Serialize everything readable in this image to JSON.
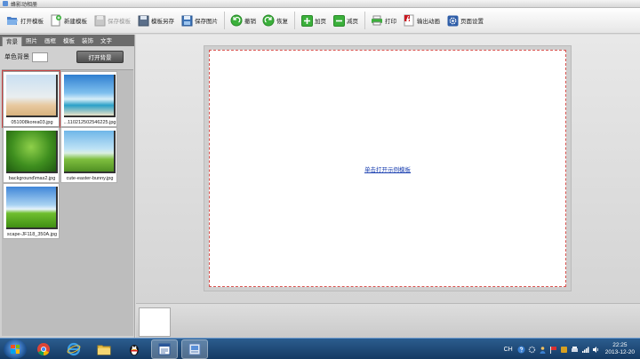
{
  "window": {
    "title": "蜂影动相册"
  },
  "toolbar": {
    "open_template": "打开模板",
    "new_template": "新建模板",
    "save_template": "保存模板",
    "template_save_as": "模板另存",
    "save_image": "保存图片",
    "undo": "撤销",
    "redo": "恢复",
    "add_page": "加页",
    "remove_page": "减页",
    "print": "打印",
    "export_animation": "输出动画",
    "page_settings": "页面设置"
  },
  "left_panel": {
    "tabs": [
      {
        "label": "背景"
      },
      {
        "label": "照片"
      },
      {
        "label": "画框"
      },
      {
        "label": "模板"
      },
      {
        "label": "装饰"
      },
      {
        "label": "文字"
      }
    ],
    "solid_bg_label": "单色背景",
    "solid_bg_color": "#ffffff",
    "open_bg_button": "打开背景",
    "thumbnails": [
      {
        "caption": "051008korea03.jpg"
      },
      {
        "caption": "...110212502546225.jpg"
      },
      {
        "caption": "background\\mas2.jpg"
      },
      {
        "caption": "cute-easter-bunny.jpg"
      },
      {
        "caption": "scape-JF118_350A.jpg"
      }
    ]
  },
  "canvas": {
    "link_text": "单击打开示例模板"
  },
  "taskbar": {
    "language": "CH",
    "clock_time": "22:25",
    "clock_date": "2013-12-20"
  },
  "colors": {
    "accent": "#d9534f",
    "link": "#1a3fb0",
    "taskbar": "#1f4a78"
  }
}
